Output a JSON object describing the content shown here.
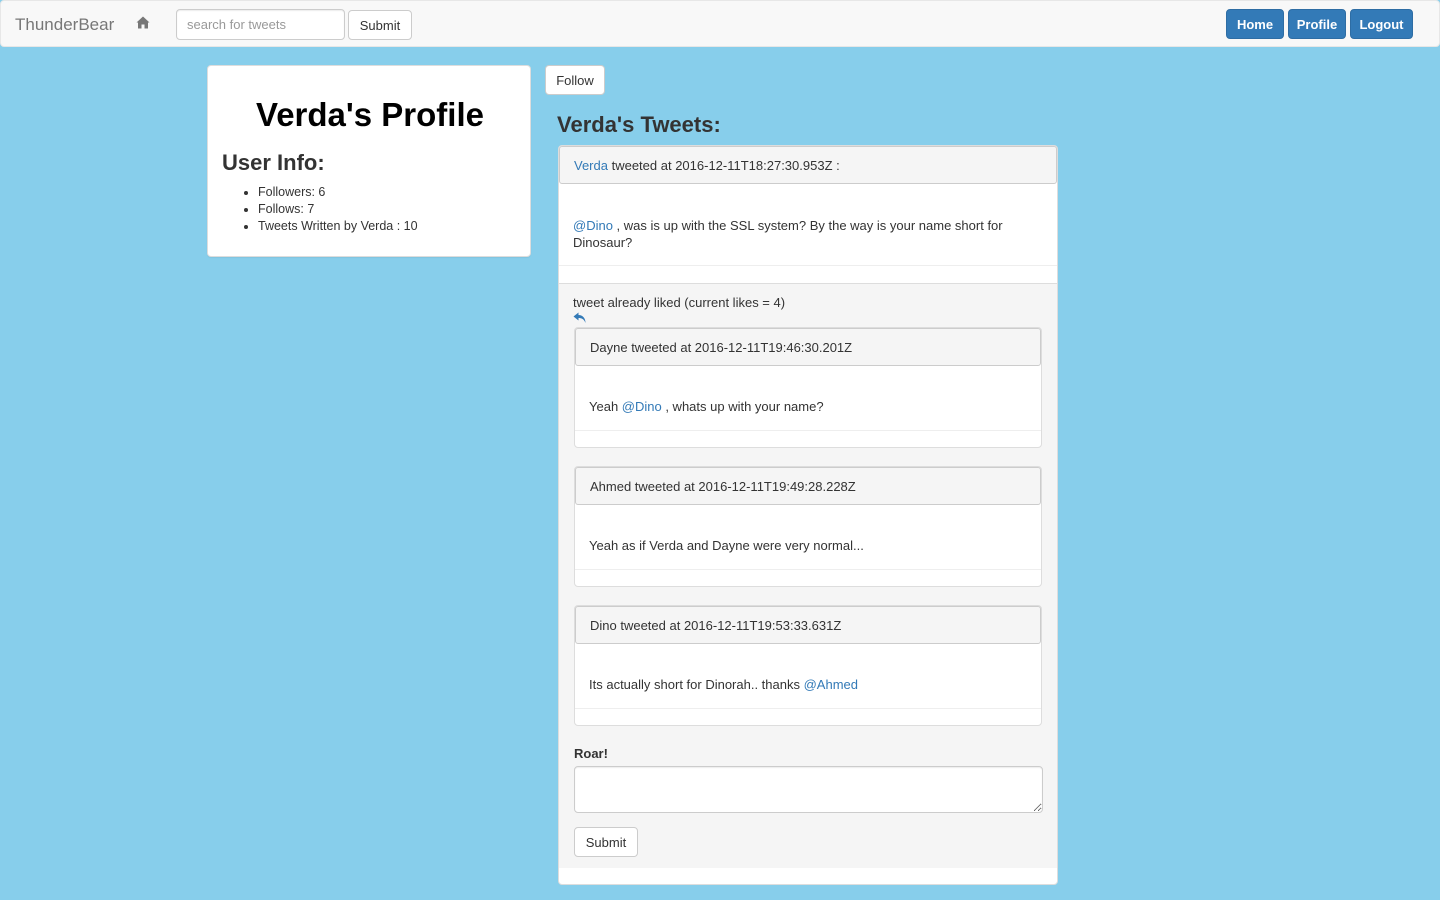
{
  "navbar": {
    "brand": "ThunderBear",
    "home_icon": "home-icon",
    "search_placeholder": "search for tweets",
    "search_value": "",
    "submit_label": "Submit",
    "buttons": {
      "home": "Home",
      "profile": "Profile",
      "logout": "Logout"
    }
  },
  "profile": {
    "title": "Verda's Profile",
    "user_info_heading": "User Info:",
    "stats": [
      "Followers: 6",
      "Follows: 7",
      "Tweets Written by Verda : 10"
    ]
  },
  "follow_label": "Follow",
  "tweets_heading": "Verda's Tweets:",
  "tweet": {
    "author": "Verda",
    "header_suffix": " tweeted at 2016-12-11T18:27:30.953Z :",
    "mention": "@Dino",
    "body_text": " , was is up with the SSL system? By the way is your name short for Dinosaur?",
    "likes_text": "tweet already liked (current likes = 4)",
    "reply_icon": "reply-icon"
  },
  "replies": [
    {
      "header": "Dayne tweeted at 2016-12-11T19:46:30.201Z",
      "pre": "Yeah ",
      "mention": "@Dino",
      "post": " , whats up with your name?"
    },
    {
      "header": "Ahmed tweeted at 2016-12-11T19:49:28.228Z",
      "pre": "Yeah as if Verda and Dayne were very normal...",
      "mention": "",
      "post": ""
    },
    {
      "header": "Dino tweeted at 2016-12-11T19:53:33.631Z",
      "pre": "Its actually short for Dinorah.. thanks ",
      "mention": "@Ahmed",
      "post": ""
    }
  ],
  "compose": {
    "label": "Roar!",
    "value": "",
    "submit_label": "Submit"
  },
  "colors": {
    "background": "#87ceeb",
    "primary": "#337ab7",
    "link": "#337ab7"
  }
}
